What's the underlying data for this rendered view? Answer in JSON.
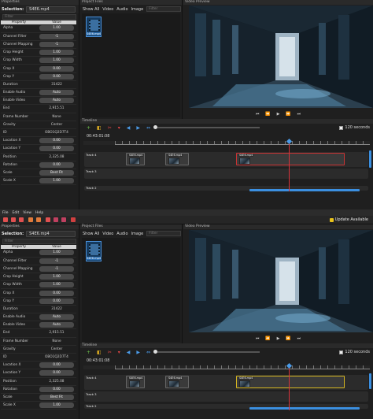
{
  "menu": [
    "File",
    "Edit",
    "View",
    "Help"
  ],
  "update_label": "Update Available",
  "properties_title": "Properties",
  "selection_label": "Selection:",
  "selection_value": "S4E6.mp4",
  "filter_placeholder": "Filter",
  "prop_headers": [
    "Property",
    "Value"
  ],
  "props": [
    {
      "name": "Alpha",
      "value": "1.00"
    },
    {
      "name": "Channel Filter",
      "value": "-1"
    },
    {
      "name": "Channel Mapping",
      "value": "-1"
    },
    {
      "name": "Crop Height",
      "value": "1.00"
    },
    {
      "name": "Crop Width",
      "value": "1.00"
    },
    {
      "name": "Crop X",
      "value": "0.00"
    },
    {
      "name": "Crop Y",
      "value": "0.00"
    },
    {
      "name": "Duration",
      "value": "31422"
    },
    {
      "name": "Enable Audio",
      "value": "Auto"
    },
    {
      "name": "Enable Video",
      "value": "Auto"
    },
    {
      "name": "End",
      "value": "2,915.51"
    },
    {
      "name": "Frame Number",
      "value": "None"
    },
    {
      "name": "Gravity",
      "value": "Center"
    },
    {
      "name": "ID",
      "value": "OBO1Q2D7T4"
    },
    {
      "name": "Location X",
      "value": "0.00"
    },
    {
      "name": "Location Y",
      "value": "0.00"
    },
    {
      "name": "Position",
      "value": "2,325.08"
    },
    {
      "name": "Rotation",
      "value": "0.00"
    },
    {
      "name": "Scale",
      "value": "Best Fit"
    },
    {
      "name": "Scale X",
      "value": "1.00"
    }
  ],
  "project_files_title": "Project Files",
  "file_tabs": [
    "Show All",
    "Video",
    "Audio",
    "Image"
  ],
  "file_name": "S4E6.mp4",
  "video_preview_title": "Video Preview",
  "timeline_title": "Timeline",
  "seconds_label": "120 seconds",
  "timecode": "00:43:01:08",
  "tracks": [
    "Track 4",
    "Track 3",
    "Track 2"
  ],
  "clips": [
    "S4E6.mp4",
    "S4E6.mp4",
    "S4E6.mp4"
  ],
  "colors": {
    "accent": "#3b8fe0",
    "playhead": "#d8323a",
    "update": "#e8c21b"
  }
}
